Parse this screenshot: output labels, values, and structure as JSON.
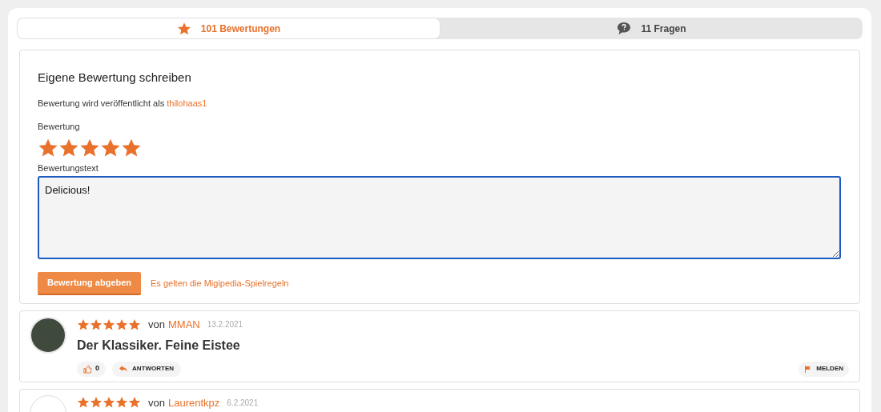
{
  "tabs": [
    {
      "kind": "star",
      "label": "101 Bewertungen",
      "selected": true
    },
    {
      "kind": "question",
      "label": "11 Fragen",
      "selected": false
    }
  ],
  "form": {
    "title": "Eigene Bewertung schreiben",
    "published_as": "Bewertung wird veröffentlicht als",
    "username": "thilohaas1",
    "rating_label": "Bewertung",
    "stars": 5,
    "text_label": "Bewertungstext",
    "text_value": "Delicious!",
    "submit": "Bewertung abgeben",
    "rules_link": "Es gelten die Migipedia-Spielregeln"
  },
  "reviews": [
    {
      "stars": 5,
      "by": "von",
      "author": "MMAN",
      "date": "13.2.2021",
      "kind": "photo",
      "text": "Der Klassiker. Feine Eistee",
      "likes": "0",
      "reply": "ANTWORTEN",
      "report": "MELDEN"
    },
    {
      "stars": 5,
      "by": "von",
      "author": "Laurentkpz",
      "date": "6.2.2021",
      "kind": "blank"
    }
  ]
}
